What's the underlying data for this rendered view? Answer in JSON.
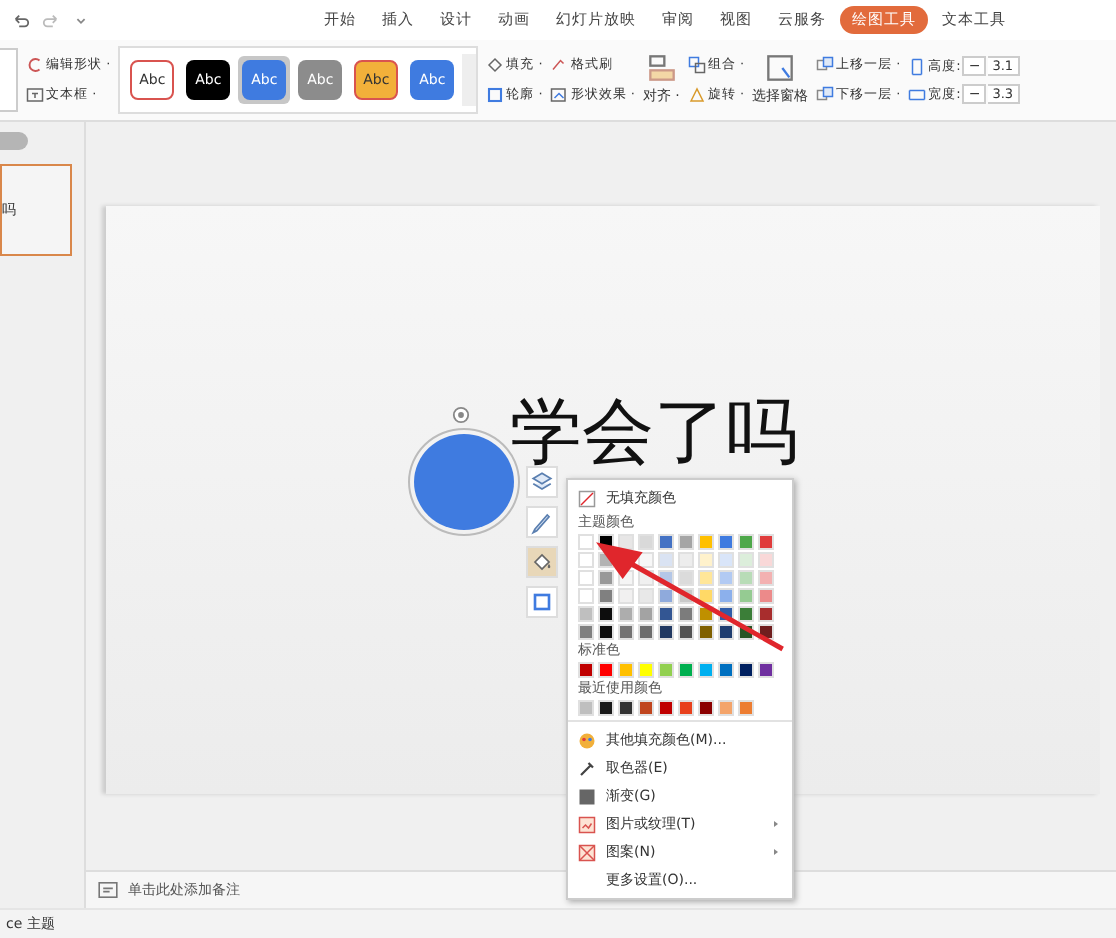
{
  "menu_tabs": [
    {
      "label": "开始",
      "selected": false
    },
    {
      "label": "插入",
      "selected": false
    },
    {
      "label": "设计",
      "selected": false
    },
    {
      "label": "动画",
      "selected": false
    },
    {
      "label": "幻灯片放映",
      "selected": false
    },
    {
      "label": "审阅",
      "selected": false
    },
    {
      "label": "视图",
      "selected": false
    },
    {
      "label": "云服务",
      "selected": false
    },
    {
      "label": "绘图工具",
      "selected": true
    },
    {
      "label": "文本工具",
      "selected": false
    }
  ],
  "ribbon": {
    "edit_group": [
      "编辑形状 ·",
      "文本框 ·"
    ],
    "styles": [
      {
        "label": "Abc",
        "color": "#ffffff",
        "selected": false
      },
      {
        "label": "Abc",
        "color": "#000000",
        "selected": false
      },
      {
        "label": "Abc",
        "color": "#3f7be0",
        "selected": true
      },
      {
        "label": "Abc",
        "color": "#8c8c8c",
        "selected": false
      },
      {
        "label": "Abc",
        "color": "#f2b03a",
        "selected": false
      },
      {
        "label": "Abc",
        "color": "#3f7be0",
        "selected": false
      }
    ],
    "format_group": [
      [
        "填充 ·",
        "格式刷"
      ],
      [
        "轮廓 ·",
        "形状效果 ·"
      ]
    ],
    "align": "对齐 ·",
    "arrange": [
      "组合 ·",
      "旋转 ·"
    ],
    "selection_pane": "选择窗格",
    "layer": [
      "上移一层 ·",
      "下移一层 ·"
    ],
    "size": [
      {
        "label": "高度:",
        "minus": "−",
        "value": "3.1"
      },
      {
        "label": "宽度:",
        "minus": "−",
        "value": "3.3"
      }
    ]
  },
  "thumbnail": {
    "text": "吗"
  },
  "slide": {
    "title": "学会了吗"
  },
  "fill_menu": {
    "no_fill": "无填充颜色",
    "theme_header": "主题颜色",
    "theme_colors": [
      {
        "color": "#ffffff"
      },
      {
        "color": "#000000"
      },
      {
        "color": "#e7e6e6"
      },
      {
        "color": "#d9d9d9"
      },
      {
        "color": "#4472c4"
      },
      {
        "color": "#a5a5a5"
      },
      {
        "color": "#ffc000"
      },
      {
        "color": "#3f7be0"
      },
      {
        "color": "#4ea84a"
      },
      {
        "color": "#e03c3c"
      }
    ],
    "standard_header": "标准色",
    "standard_colors": [
      {
        "color": "#c00000"
      },
      {
        "color": "#ff0000"
      },
      {
        "color": "#ffc000"
      },
      {
        "color": "#ffff00"
      },
      {
        "color": "#92d050"
      },
      {
        "color": "#00b050"
      },
      {
        "color": "#00b0f0"
      },
      {
        "color": "#0070c0"
      },
      {
        "color": "#002060"
      },
      {
        "color": "#7030a0"
      }
    ],
    "recent_header": "最近使用颜色",
    "recent_colors": [
      {
        "color": "#bfbfbf"
      },
      {
        "color": "#1a1a1a"
      },
      {
        "color": "#333333"
      },
      {
        "color": "#c0451e"
      },
      {
        "color": "#c00000"
      },
      {
        "color": "#e8401c"
      },
      {
        "color": "#8b0000"
      },
      {
        "color": "#f4a46a"
      },
      {
        "color": "#ed7d31"
      }
    ],
    "items": [
      {
        "kind": "palette",
        "label": "其他填充颜色(M)...",
        "submenu": false
      },
      {
        "kind": "picker",
        "label": "取色器(E)",
        "submenu": false
      },
      {
        "kind": "gradient",
        "label": "渐变(G)",
        "submenu": false
      },
      {
        "kind": "picture",
        "label": "图片或纹理(T)",
        "submenu": true
      },
      {
        "kind": "pattern",
        "label": "图案(N)",
        "submenu": true
      },
      {
        "kind": "plain",
        "label": "更多设置(O)...",
        "submenu": false
      }
    ]
  },
  "notes": {
    "placeholder": "单击此处添加备注"
  },
  "status_bar": {
    "theme": "ce 主题"
  }
}
